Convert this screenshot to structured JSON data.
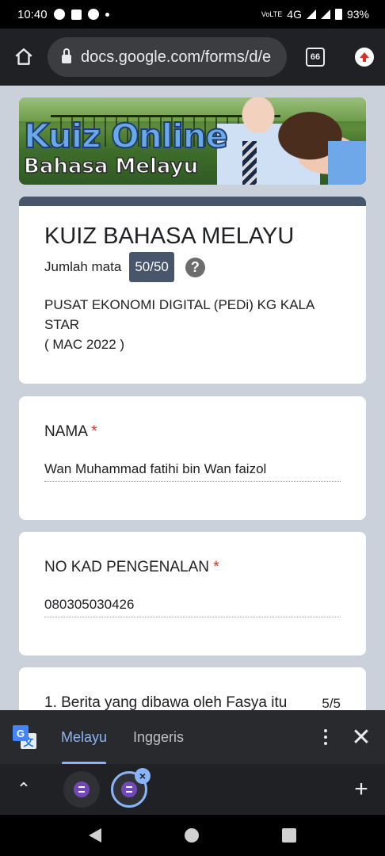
{
  "status_bar": {
    "time": "10:40",
    "network": "4G",
    "volte": "VoLTE",
    "battery": "93%"
  },
  "browser": {
    "url": "docs.google.com/forms/d/e",
    "tab_count": "66"
  },
  "banner": {
    "title": "Kuiz Online",
    "subtitle": "Bahasa Melayu"
  },
  "form": {
    "title": "KUIZ BAHASA MELAYU",
    "score_label": "Jumlah mata",
    "score_value": "50/50",
    "help": "?",
    "description_line1": "PUSAT EKONOMI DIGITAL (PEDi) KG KALA",
    "description_line2": "STAR",
    "description_line3": "( MAC 2022 )"
  },
  "questions": [
    {
      "label": "NAMA",
      "required": "*",
      "answer": "Wan Muhammad fatihi bin Wan faizol"
    },
    {
      "label": "NO KAD PENGENALAN",
      "required": "*",
      "answer": "080305030426"
    },
    {
      "label": "1. Berita yang dibawa oleh Fasya itu",
      "points": "5/5"
    }
  ],
  "translate": {
    "lang_source": "Melayu",
    "lang_target": "Inggeris"
  },
  "tab_strip": {
    "close": "×",
    "new_tab": "+"
  },
  "colors": {
    "form_accent": "#48566b",
    "page_bg": "#cbd1da",
    "translate_active": "#8ab4f8",
    "required": "#d93025"
  }
}
